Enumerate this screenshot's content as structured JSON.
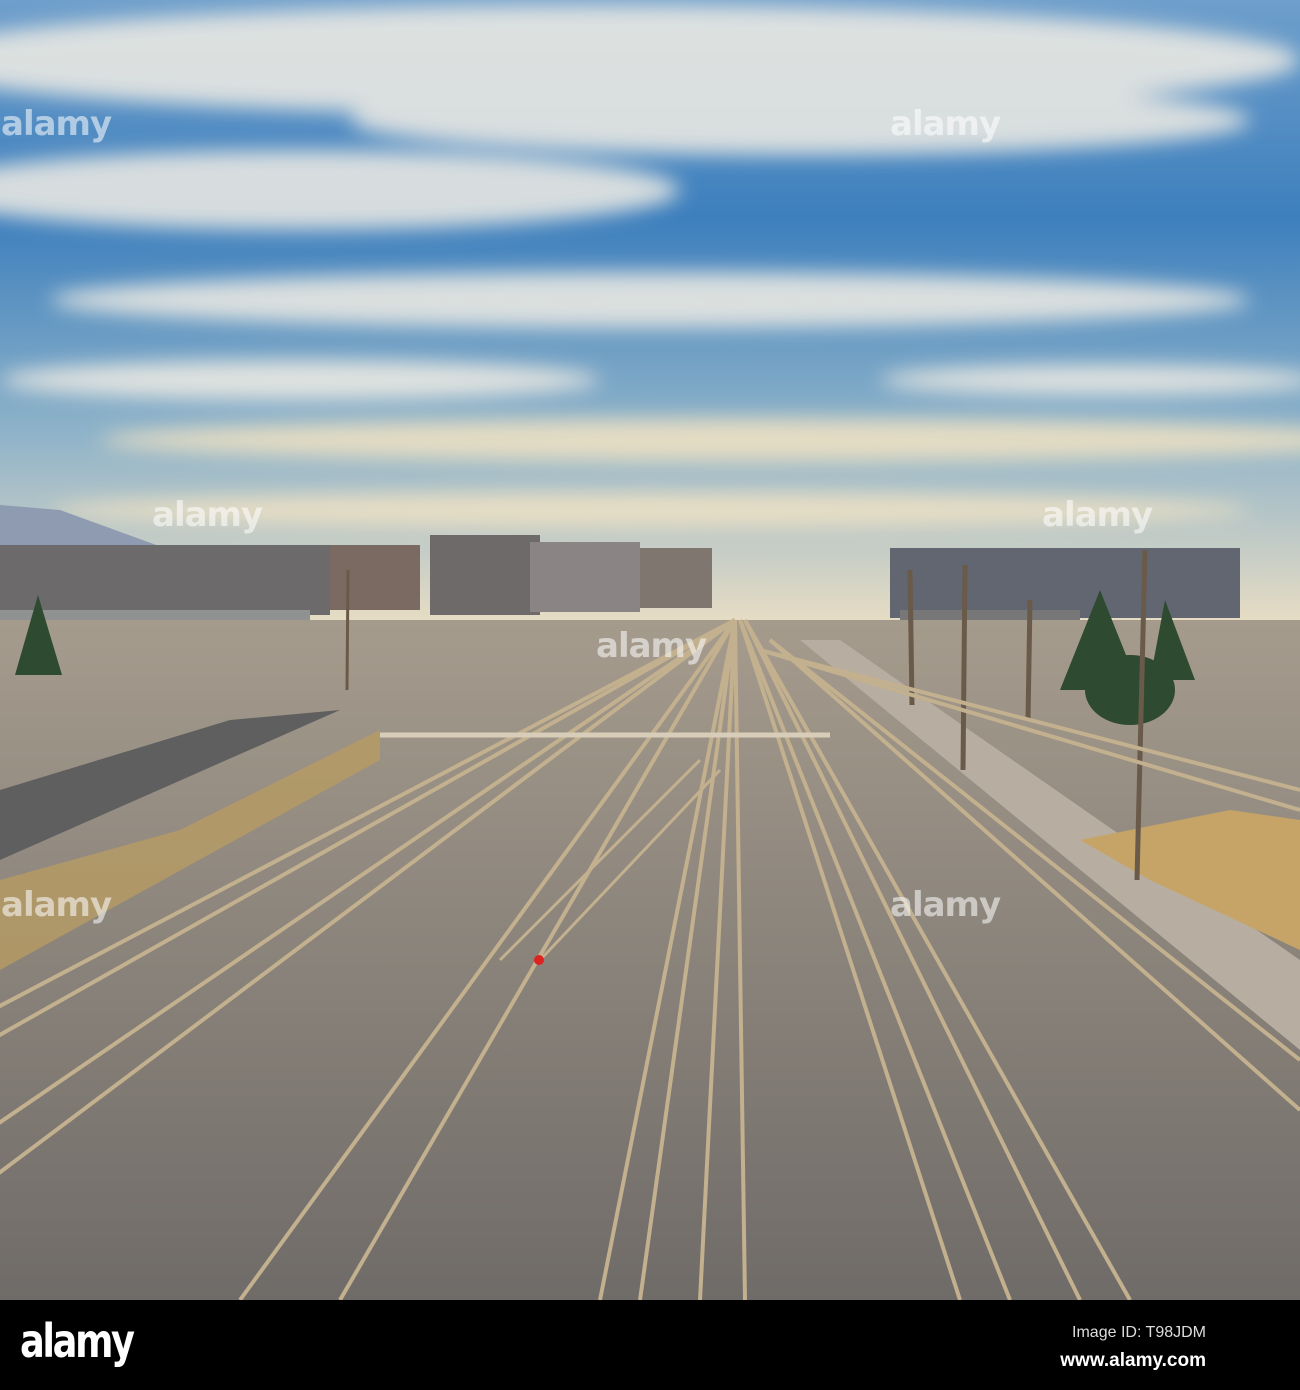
{
  "photo": {
    "subject": "Railway yard tracks converging toward a city skyline under a cloudy blue sky",
    "colors": {
      "sky_top": "#3a7fc0",
      "sky_horizon": "#e9dcc0",
      "ground": "#8c8680",
      "rail": "#b7a585"
    }
  },
  "watermark": {
    "text": "alamy"
  },
  "footer": {
    "logo": "alamy",
    "image_id": "Image ID: T98JDM",
    "website": "www.alamy.com"
  }
}
